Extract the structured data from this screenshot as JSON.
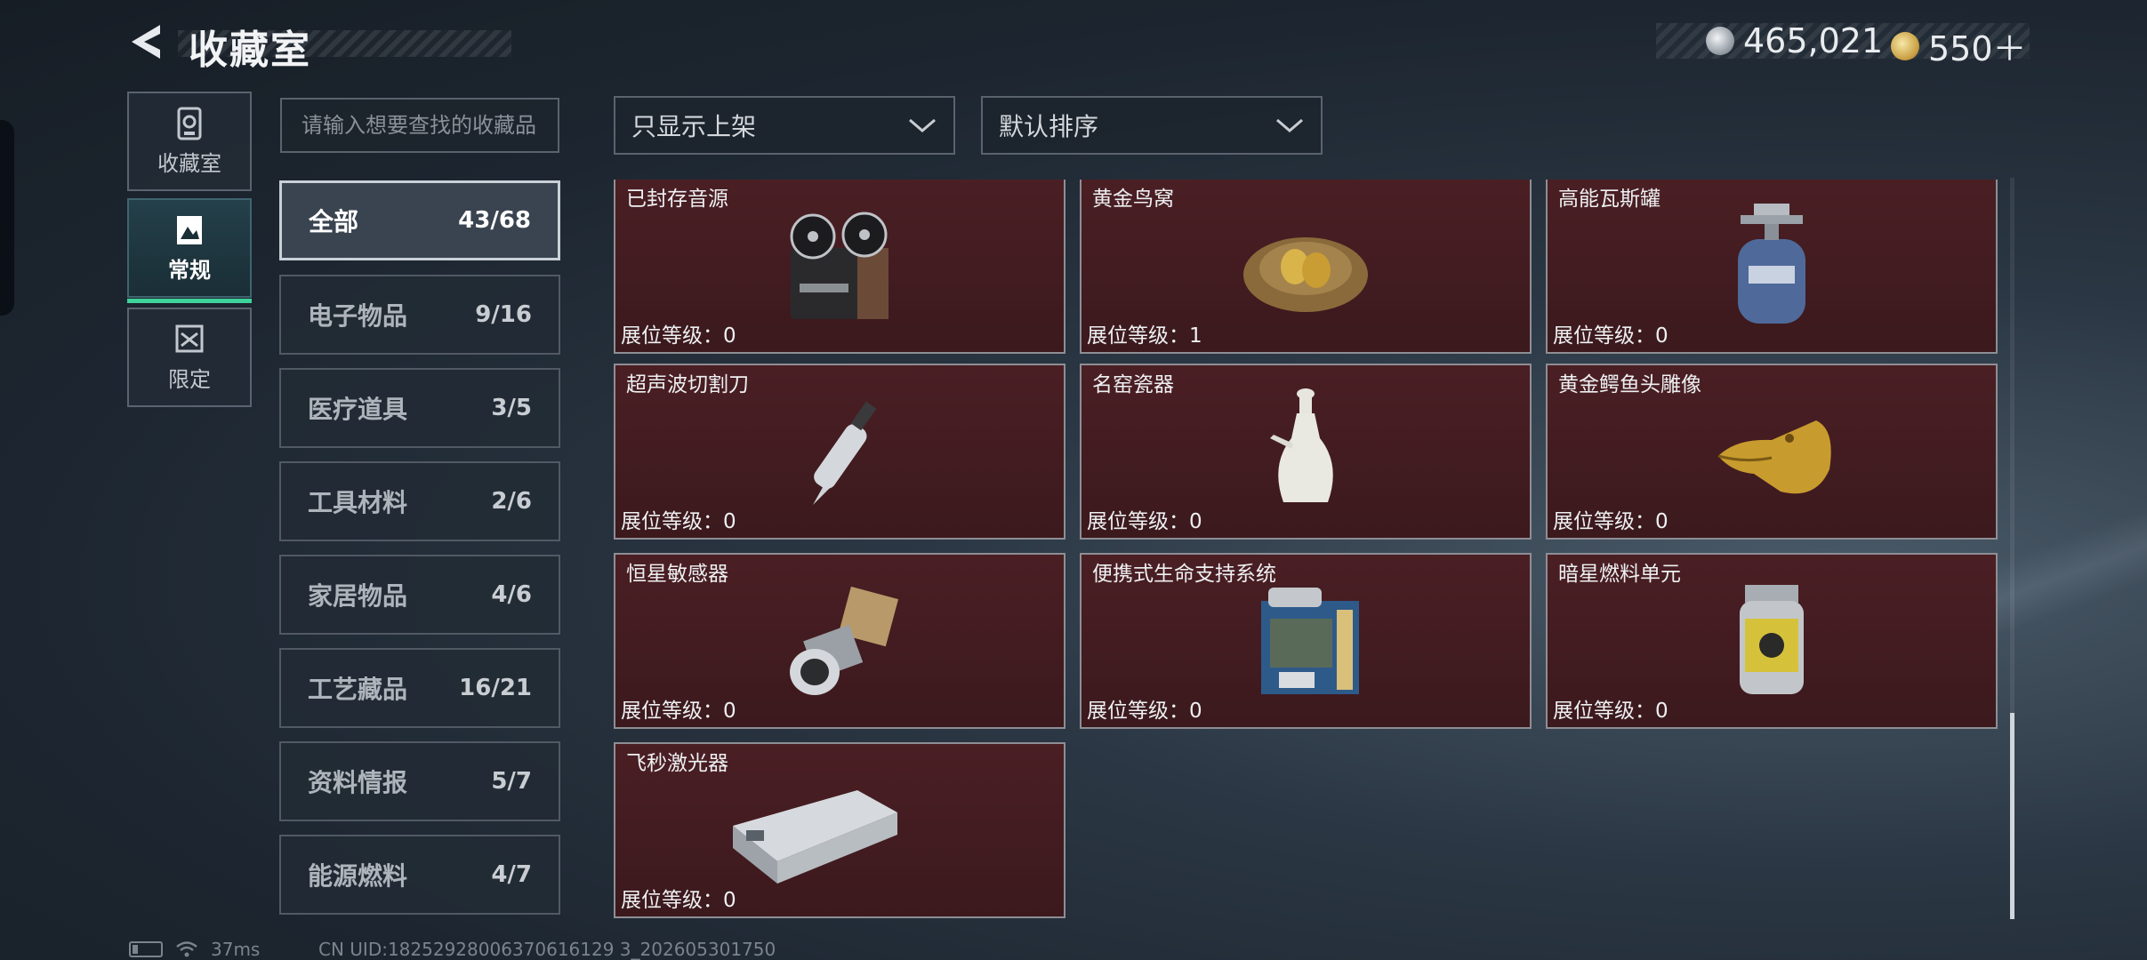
{
  "header": {
    "title": "收藏室",
    "currency": [
      {
        "value": "465,021",
        "icon": "silver-coin-icon"
      },
      {
        "value": "550＋",
        "icon": "gold-coin-icon"
      }
    ]
  },
  "nav": [
    {
      "label": "收藏室",
      "icon": "collection-icon",
      "active": false
    },
    {
      "label": "常规",
      "icon": "picture-frame-icon",
      "active": true
    },
    {
      "label": "限定",
      "icon": "limited-icon",
      "active": false
    }
  ],
  "search": {
    "placeholder": "请输入想要查找的收藏品"
  },
  "filters": {
    "show_filter": "只显示上架",
    "sort": "默认排序"
  },
  "categories": [
    {
      "label": "全部",
      "count": "43/68",
      "active": true
    },
    {
      "label": "电子物品",
      "count": "9/16"
    },
    {
      "label": "医疗道具",
      "count": "3/5"
    },
    {
      "label": "工具材料",
      "count": "2/6"
    },
    {
      "label": "家居物品",
      "count": "4/6"
    },
    {
      "label": "工艺藏品",
      "count": "16/21"
    },
    {
      "label": "资料情报",
      "count": "5/7"
    },
    {
      "label": "能源燃料",
      "count": "4/7"
    }
  ],
  "items": [
    {
      "name": "已封存音源",
      "level": "展位等级：0"
    },
    {
      "name": "黄金鸟窝",
      "level": "展位等级：1"
    },
    {
      "name": "高能瓦斯罐",
      "level": "展位等级：0"
    },
    {
      "name": "超声波切割刀",
      "level": "展位等级：0"
    },
    {
      "name": "名窑瓷器",
      "level": "展位等级：0"
    },
    {
      "name": "黄金鳄鱼头雕像",
      "level": "展位等级：0"
    },
    {
      "name": "恒星敏感器",
      "level": "展位等级：0"
    },
    {
      "name": "便携式生命支持系统",
      "level": "展位等级：0"
    },
    {
      "name": "暗星燃料单元",
      "level": "展位等级：0"
    },
    {
      "name": "飞秒激光器",
      "level": "展位等级：0"
    }
  ],
  "status": {
    "ping": "37ms",
    "uid": "CN UID:18252928006370616129 3_202605301750"
  }
}
